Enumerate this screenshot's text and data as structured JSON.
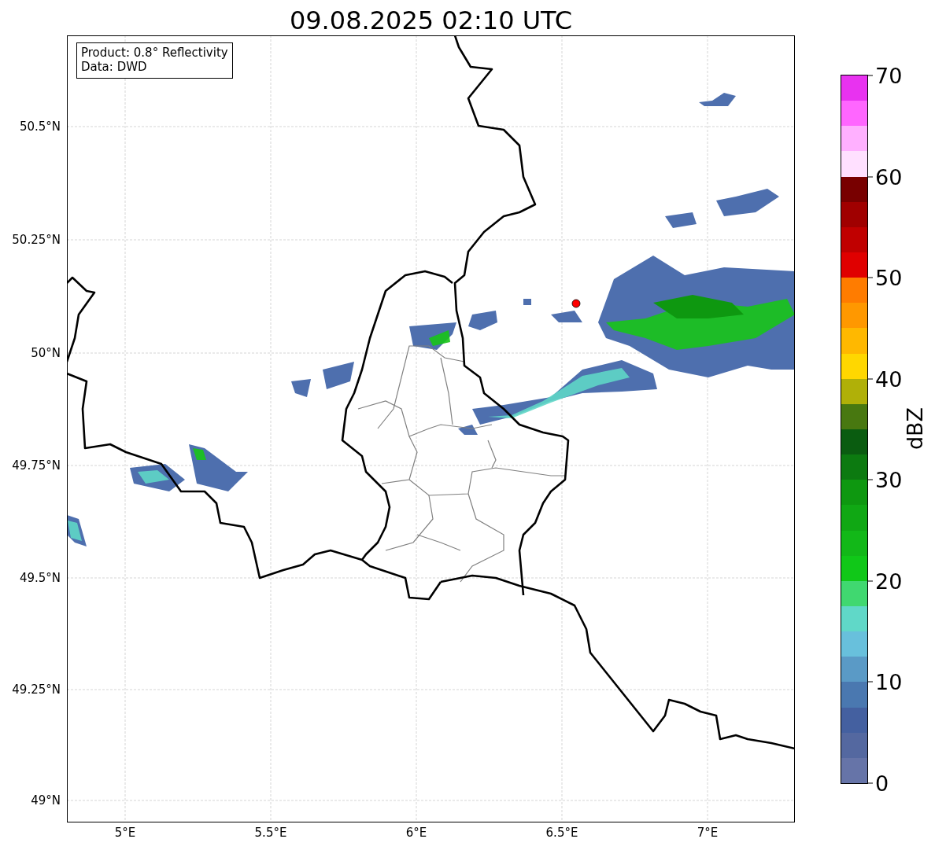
{
  "title": "09.08.2025 02:10 UTC",
  "info_box": {
    "lines": [
      "Product: 0.8° Reflectivity",
      "Data: DWD"
    ]
  },
  "map": {
    "x_ticks": [
      "5°E",
      "5.5°E",
      "6°E",
      "6.5°E",
      "7°E"
    ],
    "y_ticks": [
      "50.5°N",
      "50.25°N",
      "50°N",
      "49.75°N",
      "49.5°N",
      "49.25°N",
      "49°N"
    ]
  },
  "colorbar": {
    "label": "dBZ",
    "ticks": [
      "70",
      "60",
      "50",
      "40",
      "30",
      "20",
      "10",
      "0"
    ],
    "segments": [
      {
        "color": "#e832f0"
      },
      {
        "color": "#ff66ff"
      },
      {
        "color": "#ffb0ff"
      },
      {
        "color": "#ffe0ff"
      },
      {
        "color": "#780000"
      },
      {
        "color": "#a00000"
      },
      {
        "color": "#c00000"
      },
      {
        "color": "#e00000"
      },
      {
        "color": "#ff7c00"
      },
      {
        "color": "#ff9800"
      },
      {
        "color": "#ffb800"
      },
      {
        "color": "#ffd700"
      },
      {
        "color": "#b0b008"
      },
      {
        "color": "#487810"
      },
      {
        "color": "#0a5c10"
      },
      {
        "color": "#0c7a10"
      },
      {
        "color": "#0e9810"
      },
      {
        "color": "#10a814"
      },
      {
        "color": "#12b818"
      },
      {
        "color": "#10c818"
      },
      {
        "color": "#40d870"
      },
      {
        "color": "#60d8c8"
      },
      {
        "color": "#68c0dc"
      },
      {
        "color": "#5a9ac6"
      },
      {
        "color": "#4a78b0"
      },
      {
        "color": "#4460a0"
      },
      {
        "color": "#5468a0"
      },
      {
        "color": "#6674a8"
      }
    ]
  }
}
